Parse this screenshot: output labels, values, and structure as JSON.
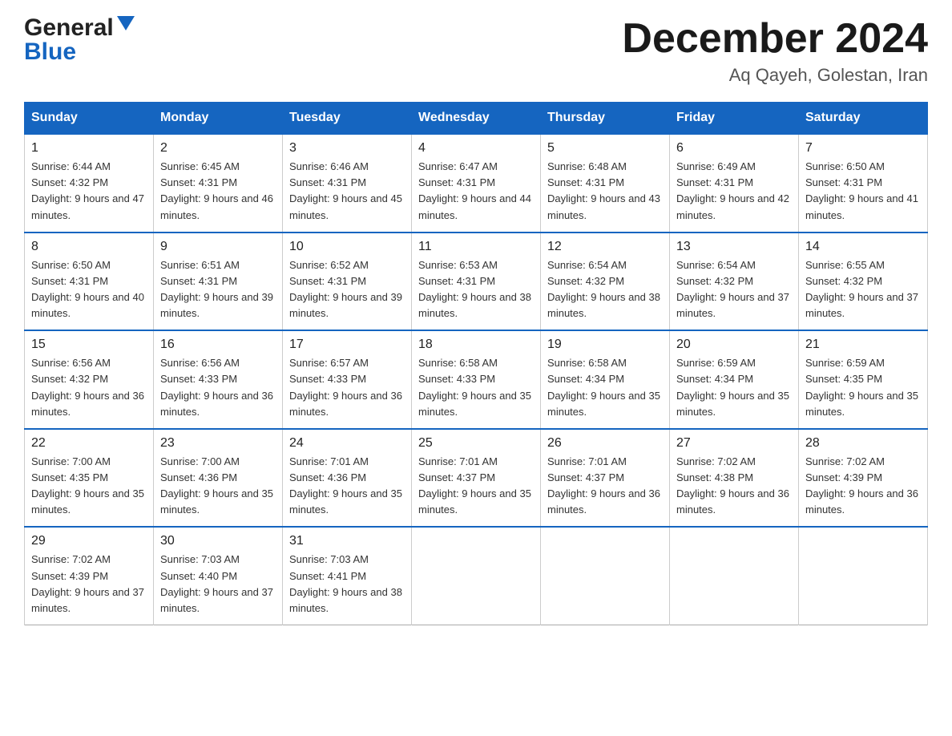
{
  "header": {
    "logo_general": "General",
    "logo_blue": "Blue",
    "month_title": "December 2024",
    "location": "Aq Qayeh, Golestan, Iran"
  },
  "calendar": {
    "days_of_week": [
      "Sunday",
      "Monday",
      "Tuesday",
      "Wednesday",
      "Thursday",
      "Friday",
      "Saturday"
    ],
    "weeks": [
      [
        {
          "num": "1",
          "sunrise": "6:44 AM",
          "sunset": "4:32 PM",
          "daylight": "9 hours and 47 minutes."
        },
        {
          "num": "2",
          "sunrise": "6:45 AM",
          "sunset": "4:31 PM",
          "daylight": "9 hours and 46 minutes."
        },
        {
          "num": "3",
          "sunrise": "6:46 AM",
          "sunset": "4:31 PM",
          "daylight": "9 hours and 45 minutes."
        },
        {
          "num": "4",
          "sunrise": "6:47 AM",
          "sunset": "4:31 PM",
          "daylight": "9 hours and 44 minutes."
        },
        {
          "num": "5",
          "sunrise": "6:48 AM",
          "sunset": "4:31 PM",
          "daylight": "9 hours and 43 minutes."
        },
        {
          "num": "6",
          "sunrise": "6:49 AM",
          "sunset": "4:31 PM",
          "daylight": "9 hours and 42 minutes."
        },
        {
          "num": "7",
          "sunrise": "6:50 AM",
          "sunset": "4:31 PM",
          "daylight": "9 hours and 41 minutes."
        }
      ],
      [
        {
          "num": "8",
          "sunrise": "6:50 AM",
          "sunset": "4:31 PM",
          "daylight": "9 hours and 40 minutes."
        },
        {
          "num": "9",
          "sunrise": "6:51 AM",
          "sunset": "4:31 PM",
          "daylight": "9 hours and 39 minutes."
        },
        {
          "num": "10",
          "sunrise": "6:52 AM",
          "sunset": "4:31 PM",
          "daylight": "9 hours and 39 minutes."
        },
        {
          "num": "11",
          "sunrise": "6:53 AM",
          "sunset": "4:31 PM",
          "daylight": "9 hours and 38 minutes."
        },
        {
          "num": "12",
          "sunrise": "6:54 AM",
          "sunset": "4:32 PM",
          "daylight": "9 hours and 38 minutes."
        },
        {
          "num": "13",
          "sunrise": "6:54 AM",
          "sunset": "4:32 PM",
          "daylight": "9 hours and 37 minutes."
        },
        {
          "num": "14",
          "sunrise": "6:55 AM",
          "sunset": "4:32 PM",
          "daylight": "9 hours and 37 minutes."
        }
      ],
      [
        {
          "num": "15",
          "sunrise": "6:56 AM",
          "sunset": "4:32 PM",
          "daylight": "9 hours and 36 minutes."
        },
        {
          "num": "16",
          "sunrise": "6:56 AM",
          "sunset": "4:33 PM",
          "daylight": "9 hours and 36 minutes."
        },
        {
          "num": "17",
          "sunrise": "6:57 AM",
          "sunset": "4:33 PM",
          "daylight": "9 hours and 36 minutes."
        },
        {
          "num": "18",
          "sunrise": "6:58 AM",
          "sunset": "4:33 PM",
          "daylight": "9 hours and 35 minutes."
        },
        {
          "num": "19",
          "sunrise": "6:58 AM",
          "sunset": "4:34 PM",
          "daylight": "9 hours and 35 minutes."
        },
        {
          "num": "20",
          "sunrise": "6:59 AM",
          "sunset": "4:34 PM",
          "daylight": "9 hours and 35 minutes."
        },
        {
          "num": "21",
          "sunrise": "6:59 AM",
          "sunset": "4:35 PM",
          "daylight": "9 hours and 35 minutes."
        }
      ],
      [
        {
          "num": "22",
          "sunrise": "7:00 AM",
          "sunset": "4:35 PM",
          "daylight": "9 hours and 35 minutes."
        },
        {
          "num": "23",
          "sunrise": "7:00 AM",
          "sunset": "4:36 PM",
          "daylight": "9 hours and 35 minutes."
        },
        {
          "num": "24",
          "sunrise": "7:01 AM",
          "sunset": "4:36 PM",
          "daylight": "9 hours and 35 minutes."
        },
        {
          "num": "25",
          "sunrise": "7:01 AM",
          "sunset": "4:37 PM",
          "daylight": "9 hours and 35 minutes."
        },
        {
          "num": "26",
          "sunrise": "7:01 AM",
          "sunset": "4:37 PM",
          "daylight": "9 hours and 36 minutes."
        },
        {
          "num": "27",
          "sunrise": "7:02 AM",
          "sunset": "4:38 PM",
          "daylight": "9 hours and 36 minutes."
        },
        {
          "num": "28",
          "sunrise": "7:02 AM",
          "sunset": "4:39 PM",
          "daylight": "9 hours and 36 minutes."
        }
      ],
      [
        {
          "num": "29",
          "sunrise": "7:02 AM",
          "sunset": "4:39 PM",
          "daylight": "9 hours and 37 minutes."
        },
        {
          "num": "30",
          "sunrise": "7:03 AM",
          "sunset": "4:40 PM",
          "daylight": "9 hours and 37 minutes."
        },
        {
          "num": "31",
          "sunrise": "7:03 AM",
          "sunset": "4:41 PM",
          "daylight": "9 hours and 38 minutes."
        },
        null,
        null,
        null,
        null
      ]
    ]
  }
}
